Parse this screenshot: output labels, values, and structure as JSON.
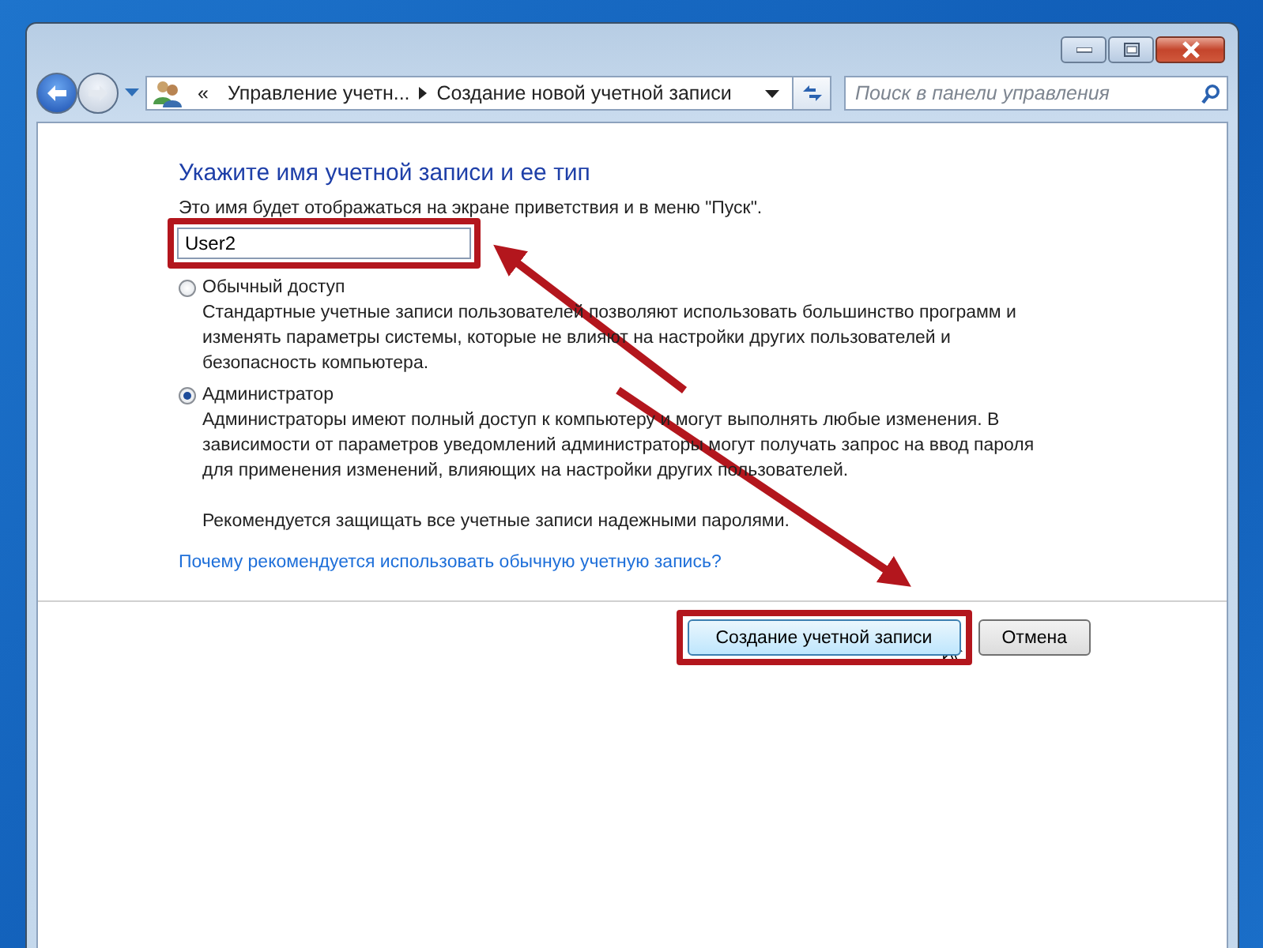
{
  "window": {
    "controls": [
      {
        "kind": "minimize"
      },
      {
        "kind": "maximize"
      },
      {
        "kind": "close"
      }
    ]
  },
  "nav": {
    "overflow": "«",
    "crumbs": [
      "Управление учетн...",
      "Создание новой учетной записи"
    ],
    "search": {
      "placeholder": "Поиск в панели управления"
    }
  },
  "heading": "Укажите имя учетной записи и ее тип",
  "hint": "Это имя будет отображаться на экране приветствия и в меню \"Пуск\".",
  "name_field": {
    "value": "User2"
  },
  "options": [
    {
      "label": "Обычный доступ",
      "selected": false,
      "description": [
        "Стандартные учетные записи пользователей позволяют использовать большинство программ и изменять параметры системы, которые не влияют на настройки других пользователей и безопасность компьютера."
      ]
    },
    {
      "label": "Администратор",
      "selected": true,
      "description": [
        "Администраторы имеют полный доступ к компьютеру и могут выполнять любые изменения. В зависимости от параметров уведомлений администраторы могут получать запрос на ввод пароля для применения изменений, влияющих на настройки других пользователей.",
        "Рекомендуется защищать все учетные записи надежными паролями."
      ]
    }
  ],
  "link": "Почему рекомендуется использовать обычную учетную запись?",
  "buttons": [
    {
      "label": "Создание учетной записи",
      "kind": "primary"
    },
    {
      "label": "Отмена",
      "kind": "secondary"
    }
  ]
}
